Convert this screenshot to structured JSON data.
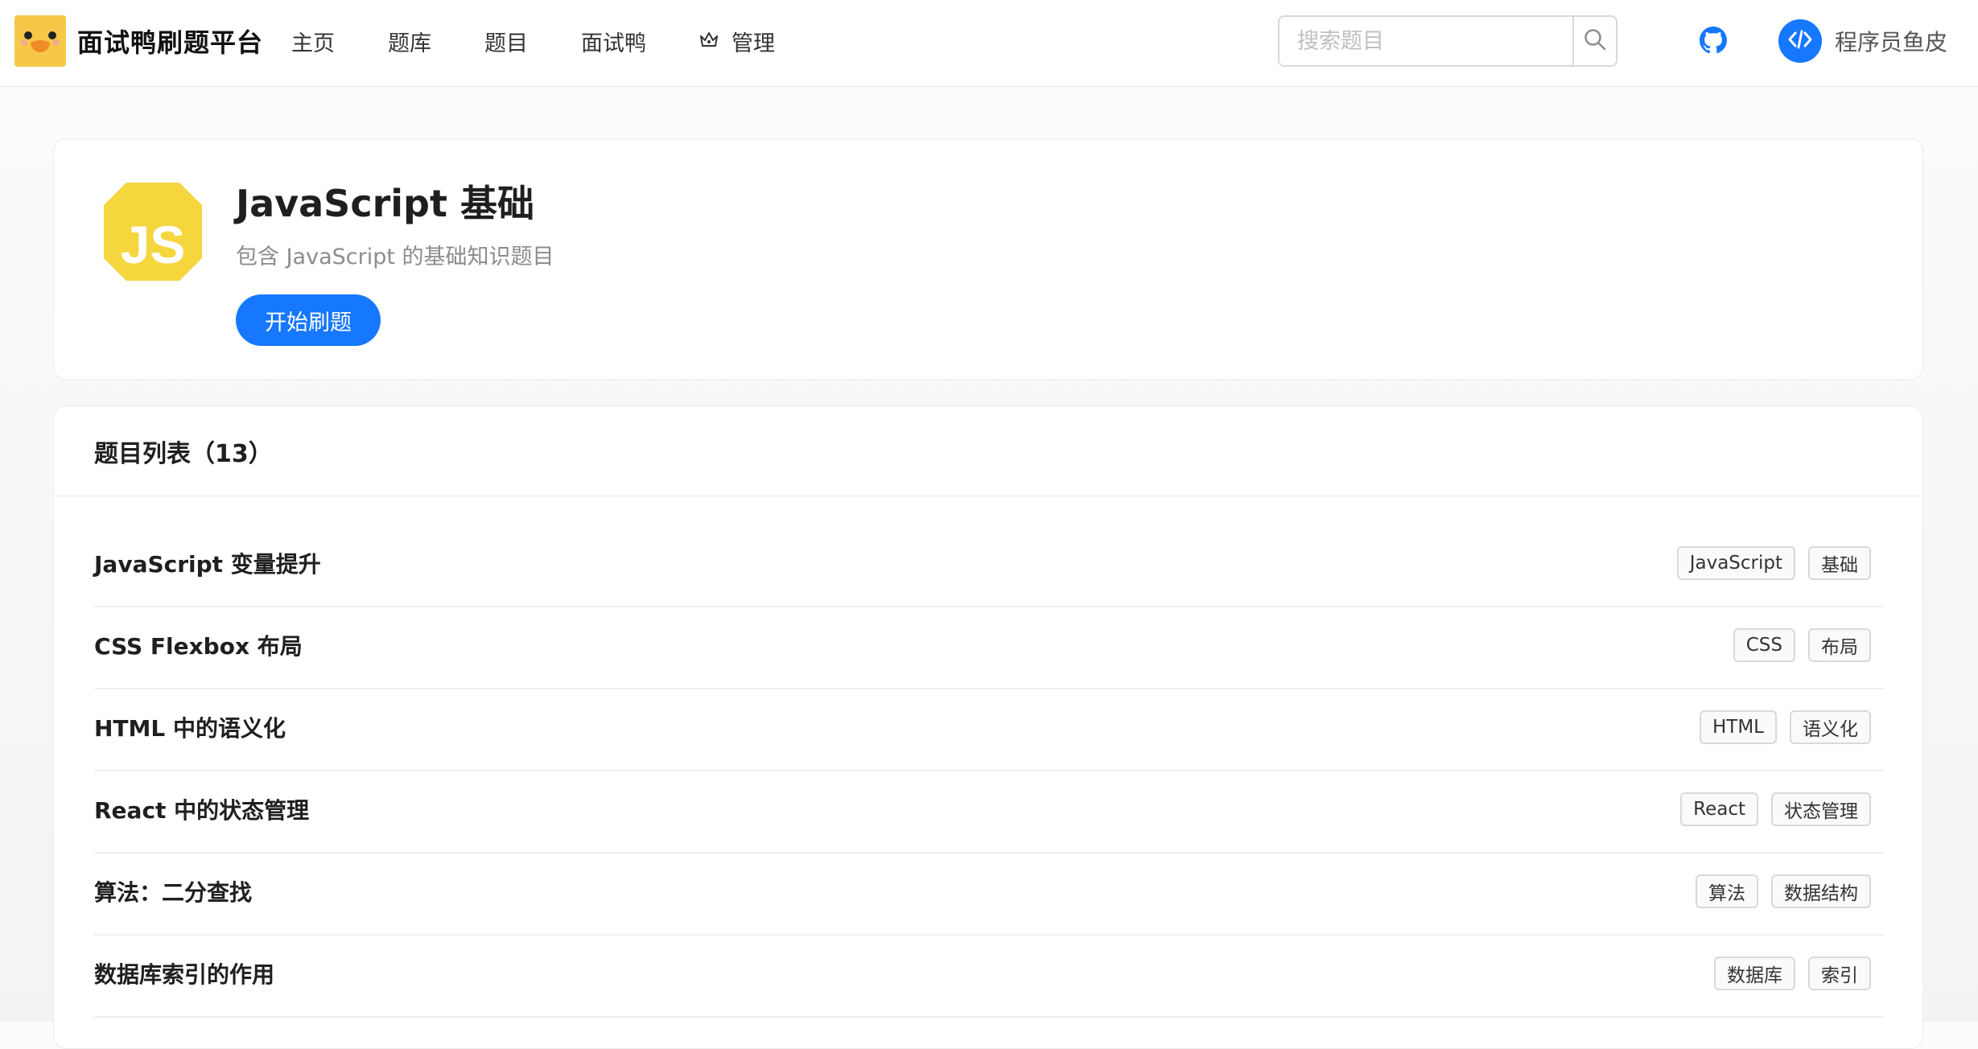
{
  "header": {
    "brand_name": "面试鸭刷题平台",
    "nav": [
      {
        "label": "主页"
      },
      {
        "label": "题库"
      },
      {
        "label": "题目"
      },
      {
        "label": "面试鸭"
      },
      {
        "label": "管理",
        "icon": "crown-icon"
      }
    ],
    "search_placeholder": "搜索题目",
    "user_name": "程序员鱼皮"
  },
  "bank": {
    "title": "JavaScript 基础",
    "description": "包含 JavaScript 的基础知识题目",
    "start_label": "开始刷题",
    "icon_text": "JS",
    "icon_color": "#f5d63d"
  },
  "question_list": {
    "title": "题目列表（13）",
    "items": [
      {
        "title": "JavaScript 变量提升",
        "tags": [
          "JavaScript",
          "基础"
        ]
      },
      {
        "title": "CSS Flexbox 布局",
        "tags": [
          "CSS",
          "布局"
        ]
      },
      {
        "title": "HTML 中的语义化",
        "tags": [
          "HTML",
          "语义化"
        ]
      },
      {
        "title": "React 中的状态管理",
        "tags": [
          "React",
          "状态管理"
        ]
      },
      {
        "title": "算法：二分查找",
        "tags": [
          "算法",
          "数据结构"
        ]
      },
      {
        "title": "数据库索引的作用",
        "tags": [
          "数据库",
          "索引"
        ]
      }
    ]
  },
  "colors": {
    "primary": "#1677ff",
    "logo_bg": "#f6c84a"
  }
}
